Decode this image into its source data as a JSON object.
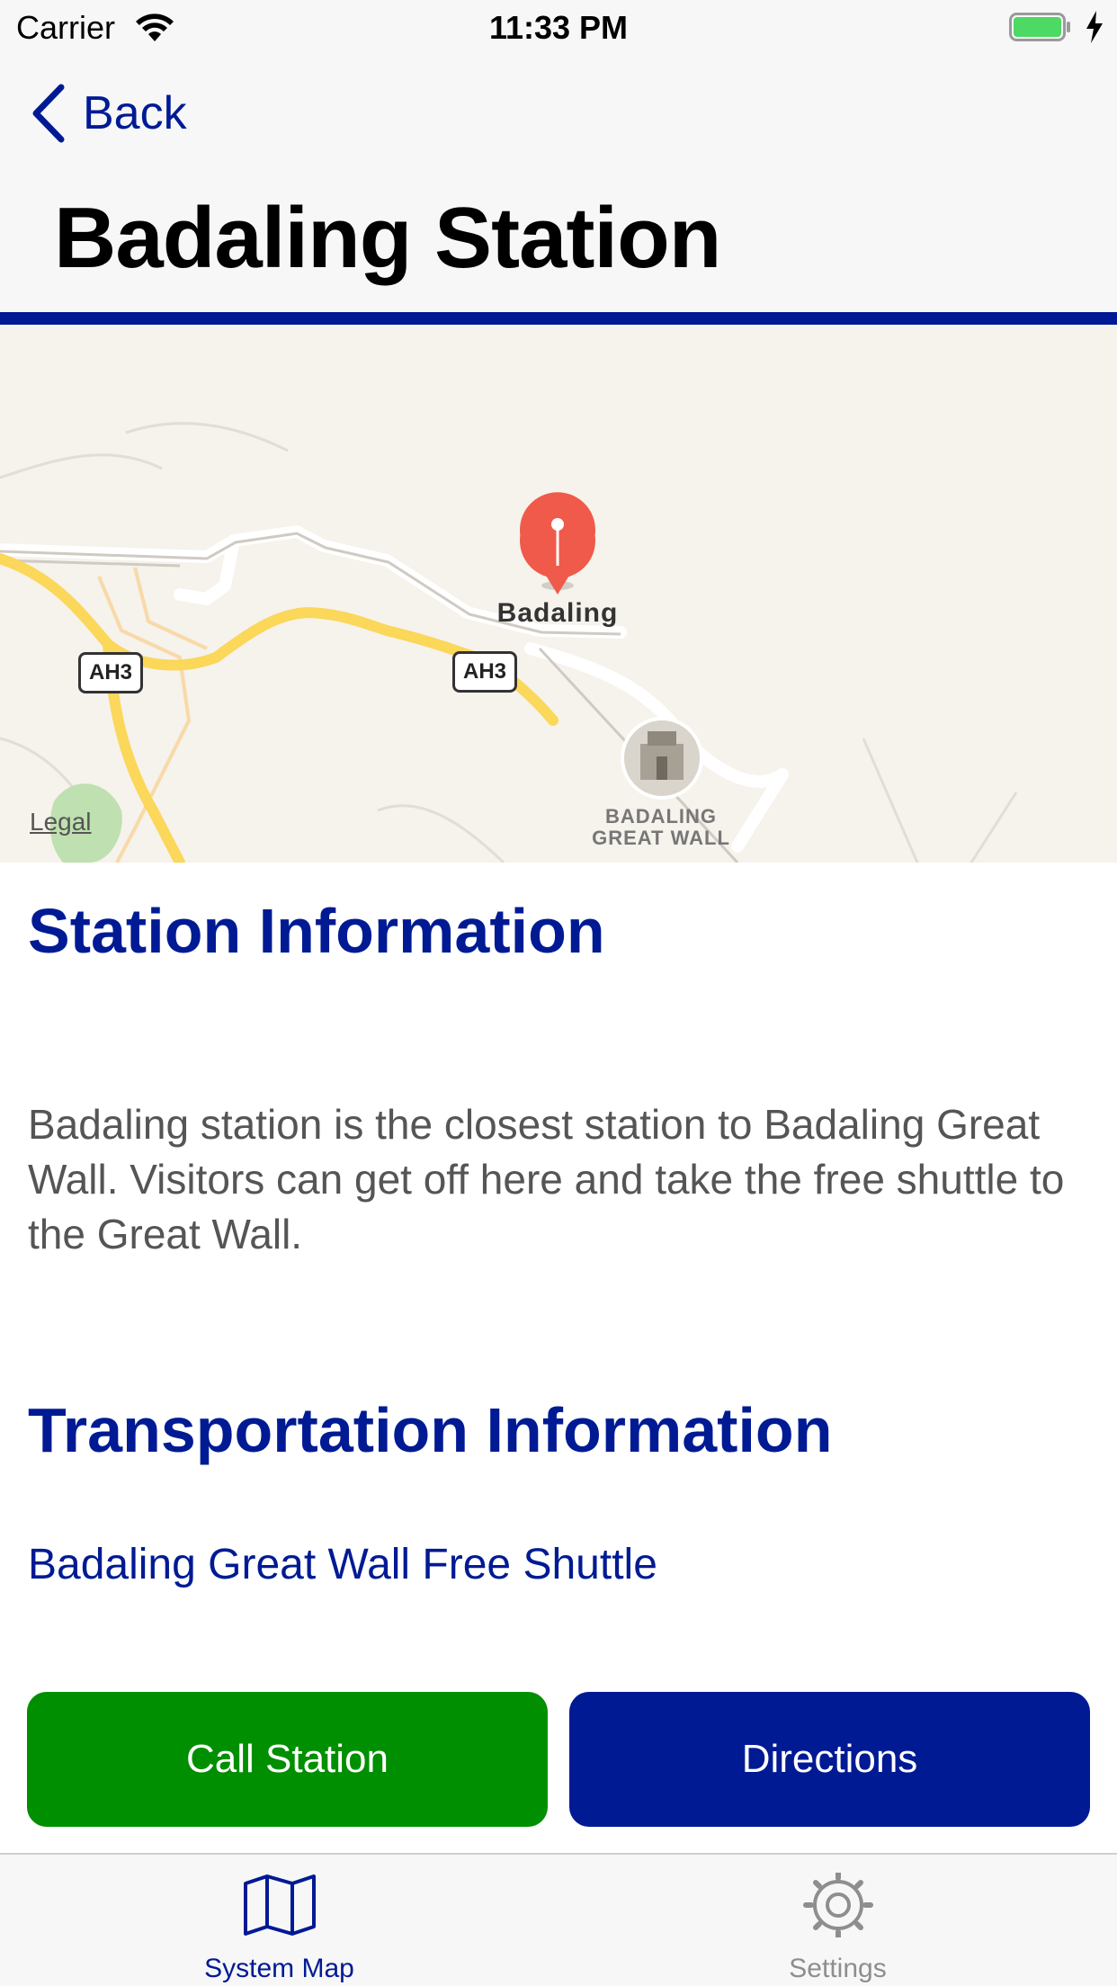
{
  "status_bar": {
    "carrier": "Carrier",
    "time": "11:33 PM",
    "battery_color": "#4cd964"
  },
  "nav": {
    "back_label": "Back",
    "title": "Badaling Station"
  },
  "map": {
    "pin_label": "Badaling",
    "landmark_label_line1": "BADALING",
    "landmark_label_line2": "GREAT WALL",
    "road_shield_1": "AH3",
    "road_shield_2": "AH3",
    "legal": "Legal",
    "pin_color": "#f05a4a"
  },
  "station_info": {
    "heading": "Station Information",
    "description": "Badaling station is the closest station to Badaling Great Wall. Visitors can get off here and take the free shuttle to the Great Wall."
  },
  "transport_info": {
    "heading": "Transportation Information",
    "link": "Badaling Great Wall Free Shuttle"
  },
  "actions": {
    "call_label": "Call Station",
    "directions_label": "Directions",
    "call_color": "#008f00",
    "directions_color": "#001a94"
  },
  "tab_bar": {
    "tabs": [
      {
        "label": "System Map",
        "icon": "map-icon",
        "selected": true
      },
      {
        "label": "Settings",
        "icon": "gear-icon",
        "selected": false
      }
    ]
  }
}
